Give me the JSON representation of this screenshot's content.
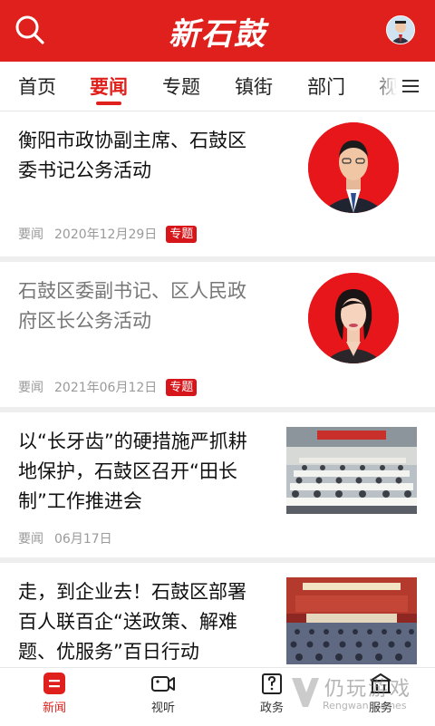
{
  "header": {
    "logo_text": "新石鼓",
    "colors": {
      "brand_red": "#e0201c",
      "badge_red": "#d7161b"
    }
  },
  "icons": {
    "search": "search-icon",
    "user": "avatar-icon",
    "menu": "menu-icon"
  },
  "tabs": [
    {
      "label": "首页",
      "active": false
    },
    {
      "label": "要闻",
      "active": true
    },
    {
      "label": "专题",
      "active": false
    },
    {
      "label": "镇街",
      "active": false
    },
    {
      "label": "部门",
      "active": false
    },
    {
      "label": "视",
      "active": false
    }
  ],
  "news": [
    {
      "title": "衡阳市政协副主席、石鼓区委书记公务活动",
      "category": "要闻",
      "date": "2020年12月29日",
      "badge": "专题"
    },
    {
      "title": "石鼓区委副书记、区人民政府区长公务活动",
      "category": "要闻",
      "date": "2021年06月12日",
      "badge": "专题"
    },
    {
      "title": "以“长牙齿”的硬措施严抓耕地保护，石鼓区召开“田长制”工作推进会",
      "category": "要闻",
      "date": "06月17日"
    },
    {
      "title": "走，到企业去！石鼓区部署百人联百企“送政策、解难题、优服务”百日行动"
    }
  ],
  "bottom_nav": [
    {
      "label": "新闻",
      "icon": "news-icon",
      "active": true
    },
    {
      "label": "视听",
      "icon": "video-icon",
      "active": false
    },
    {
      "label": "政务",
      "icon": "government-icon",
      "active": false
    },
    {
      "label": "服务",
      "icon": "service-icon",
      "active": false
    }
  ],
  "watermark": {
    "text": "仍玩游戏",
    "sub": "Rengwan Games"
  }
}
